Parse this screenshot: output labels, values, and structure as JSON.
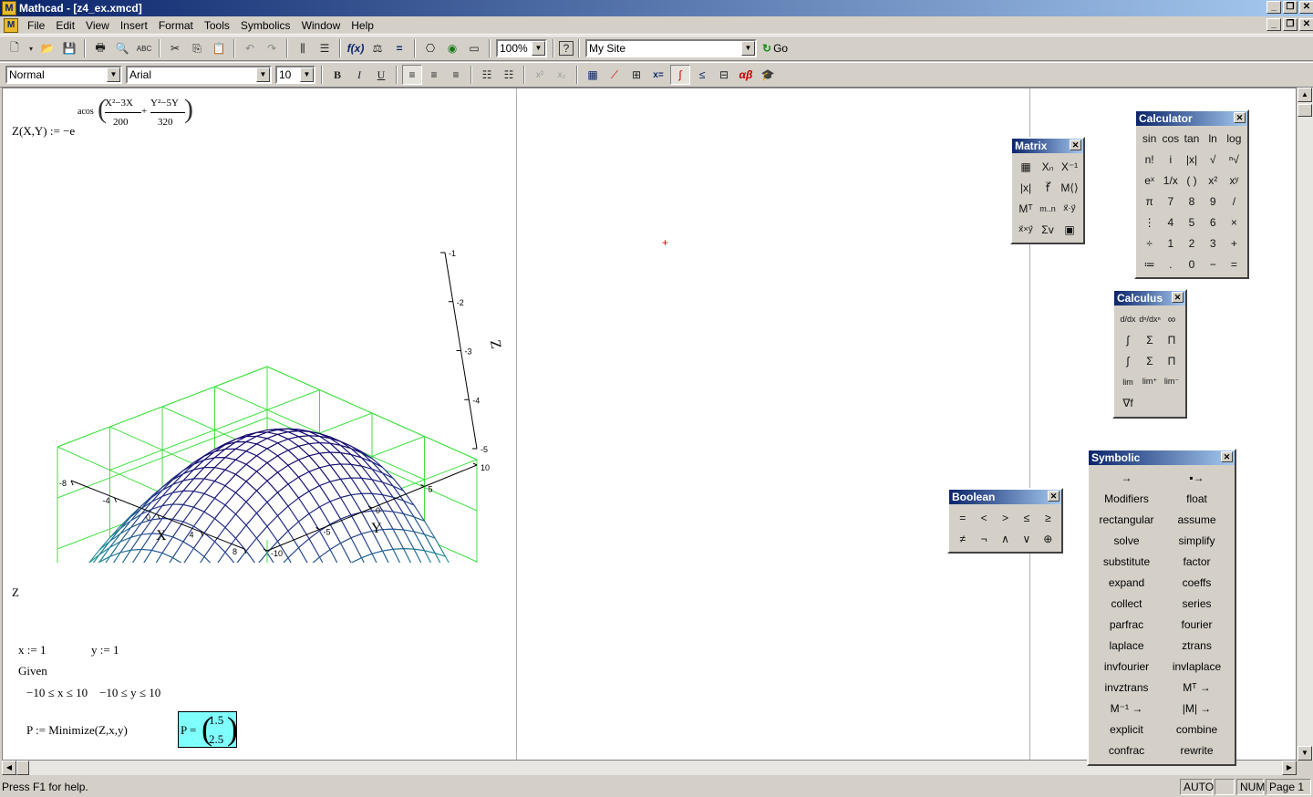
{
  "window": {
    "title": "Mathcad - [z4_ex.xmcd]"
  },
  "menu": [
    "File",
    "Edit",
    "View",
    "Insert",
    "Format",
    "Tools",
    "Symbolics",
    "Window",
    "Help"
  ],
  "toolbar": {
    "zoom": "100%",
    "site": "My Site",
    "go_label": "Go"
  },
  "format_bar": {
    "style": "Normal",
    "font": "Arial",
    "size": "10"
  },
  "worksheet": {
    "definition": "Z(X,Y) := −e",
    "exponent_func": "acos",
    "exp_num1": "X²−3X",
    "exp_den1": "200",
    "exp_num2": "Y²−5Y",
    "exp_den2": "320",
    "plot_label": "Z",
    "x_assign": "x := 1",
    "y_assign": "y := 1",
    "given": "Given",
    "constraints": "−10 ≤ x ≤ 10    −10 ≤ y ≤ 10",
    "minimize": "P := Minimize(Z,x,y)",
    "result_label": "P =",
    "result_values": [
      "1.5",
      "2.5"
    ]
  },
  "plot": {
    "z_ticks": [
      "-1",
      "-2",
      "-3",
      "-4",
      "-5"
    ],
    "x_ticks": [
      "-8",
      "-4",
      "0",
      "4",
      "8"
    ],
    "y_ticks": [
      "-10",
      "-5",
      "0",
      "5",
      "10"
    ],
    "x_axis_label": "X",
    "y_axis_label": "Y",
    "z_axis_label": "Z"
  },
  "palettes": {
    "matrix": {
      "title": "Matrix"
    },
    "calculator": {
      "title": "Calculator",
      "keys": [
        "sin",
        "cos",
        "tan",
        "ln",
        "log",
        "n!",
        "i",
        "|x|",
        "√",
        "ⁿ√",
        "eˣ",
        "1/x",
        "( )",
        "x²",
        "xʸ",
        "π",
        "7",
        "8",
        "9",
        "/",
        "⋮",
        "4",
        "5",
        "6",
        "×",
        "÷",
        "1",
        "2",
        "3",
        "+",
        "≔",
        ".",
        "0",
        "−",
        "="
      ]
    },
    "calculus": {
      "title": "Calculus"
    },
    "boolean": {
      "title": "Boolean",
      "keys": [
        "=",
        "<",
        ">",
        "≤",
        "≥",
        "≠",
        "¬",
        "∧",
        "∨",
        "⊕"
      ]
    },
    "symbolic": {
      "title": "Symbolic",
      "keys": [
        "→",
        "▪→",
        "Modifiers",
        "float",
        "rectangular",
        "assume",
        "solve",
        "simplify",
        "substitute",
        "factor",
        "expand",
        "coeffs",
        "collect",
        "series",
        "parfrac",
        "fourier",
        "laplace",
        "ztrans",
        "invfourier",
        "invlaplace",
        "invztrans",
        "Mᵀ →",
        "M⁻¹ →",
        "|M| →",
        "explicit",
        "combine",
        "confrac",
        "rewrite"
      ]
    }
  },
  "status": {
    "help": "Press F1 for help.",
    "auto": "AUTO",
    "num": "NUM",
    "page": "Page 1"
  }
}
